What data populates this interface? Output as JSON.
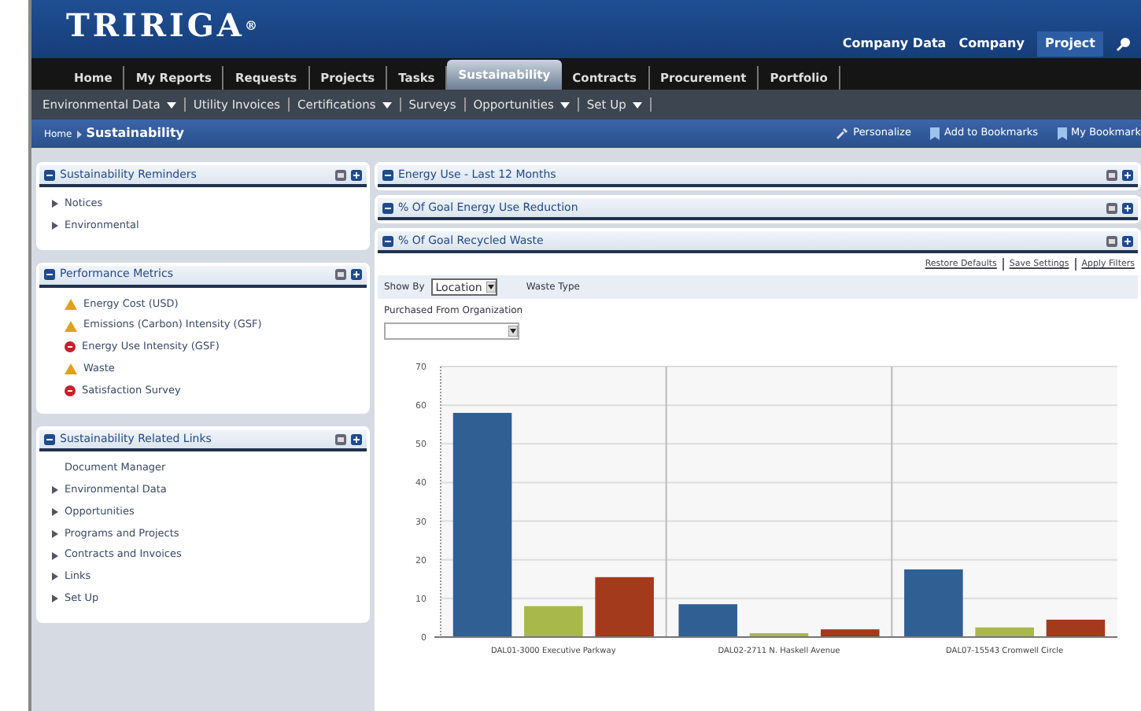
{
  "header": {
    "logo": "TRIRIGA$^{®}$",
    "links": [
      {
        "label": "Company Data",
        "kind": "text"
      },
      {
        "label": "Company",
        "kind": "text"
      },
      {
        "label": "Project",
        "kind": "box"
      }
    ]
  },
  "nav": [
    {
      "label": "Home",
      "selected": false
    },
    {
      "label": "My Reports",
      "selected": false
    },
    {
      "label": "Requests",
      "selected": false
    },
    {
      "label": "Projects",
      "selected": false
    },
    {
      "label": "Tasks",
      "selected": false
    },
    {
      "label": "Sustainability",
      "selected": true
    },
    {
      "label": "Contracts",
      "selected": false
    },
    {
      "label": "Procurement",
      "selected": false
    },
    {
      "label": "Portfolio",
      "selected": false
    }
  ],
  "subnav": [
    {
      "label": "Environmental Data",
      "has_menu": true
    },
    {
      "label": "Utility Invoices",
      "has_menu": false
    },
    {
      "label": "Certifications",
      "has_menu": true
    },
    {
      "label": "Surveys",
      "has_menu": false
    },
    {
      "label": "Opportunities",
      "has_menu": true
    },
    {
      "label": "Set Up",
      "has_menu": true
    }
  ],
  "breadcrumb": {
    "items": [
      "Home",
      "Sustainability"
    ],
    "actions": [
      {
        "label": "Personalize",
        "kind": "wrench"
      },
      {
        "label": "Add to Bookmarks",
        "kind": "bookmark"
      },
      {
        "label": "My Bookmark",
        "kind": "bookmark"
      }
    ]
  },
  "left_portlets": [
    {
      "title": "Sustainability Reminders",
      "items": [
        {
          "label": "Notices",
          "kind": "bullet"
        },
        {
          "label": "Environmental",
          "kind": "bullet"
        }
      ]
    },
    {
      "title": "Performance Metrics",
      "items": [
        {
          "label": "Energy Cost (USD)",
          "kind": "warning"
        },
        {
          "label": "Emissions (Carbon) Intensity (GSF)",
          "kind": "warning"
        },
        {
          "label": "Energy Use Intensity (GSF)",
          "kind": "error"
        },
        {
          "label": "Waste",
          "kind": "warning"
        },
        {
          "label": "Satisfaction Survey",
          "kind": "error"
        }
      ]
    },
    {
      "title": "Sustainability Related Links",
      "items": [
        {
          "label": "Document Manager",
          "kind": "plain"
        },
        {
          "label": "Environmental Data",
          "kind": "bullet"
        },
        {
          "label": "Opportunities",
          "kind": "bullet"
        },
        {
          "label": "Programs and Projects",
          "kind": "bullet"
        },
        {
          "label": "Contracts and Invoices",
          "kind": "bullet"
        },
        {
          "label": "Links",
          "kind": "bullet"
        },
        {
          "label": "Set Up",
          "kind": "bullet"
        }
      ]
    }
  ],
  "right_portlets": [
    {
      "title": "Energy Use - Last 12 Months"
    },
    {
      "title": "% Of Goal Energy Use Reduction"
    },
    {
      "title": "% Of Goal Recycled Waste"
    }
  ],
  "recycled_waste": {
    "links": [
      "Restore Defaults",
      "Save Settings",
      "Apply Filters"
    ],
    "show_by_label": "Show By",
    "show_by_value": "Location",
    "waste_type_label": "Waste Type",
    "organization_label": "Purchased From Organization",
    "chart_data": {
      "type": "bar",
      "categories": [
        "DAL01-3000 Executive Parkway",
        "DAL02-2711 N. Haskell Avenue",
        "DAL07-15543 Cromwell Circle"
      ],
      "series": [
        {
          "color": "#2f5f93",
          "values": [
            58,
            8.5,
            17.5
          ]
        },
        {
          "color": "#a9b84a",
          "values": [
            8,
            1,
            2.5
          ]
        },
        {
          "color": "#a33a1c",
          "values": [
            15.5,
            2,
            4.5
          ]
        }
      ],
      "grid": true,
      "ylim": [
        0,
        70
      ],
      "yticks": [
        0,
        10,
        20,
        30,
        40,
        50,
        60,
        70
      ]
    }
  }
}
